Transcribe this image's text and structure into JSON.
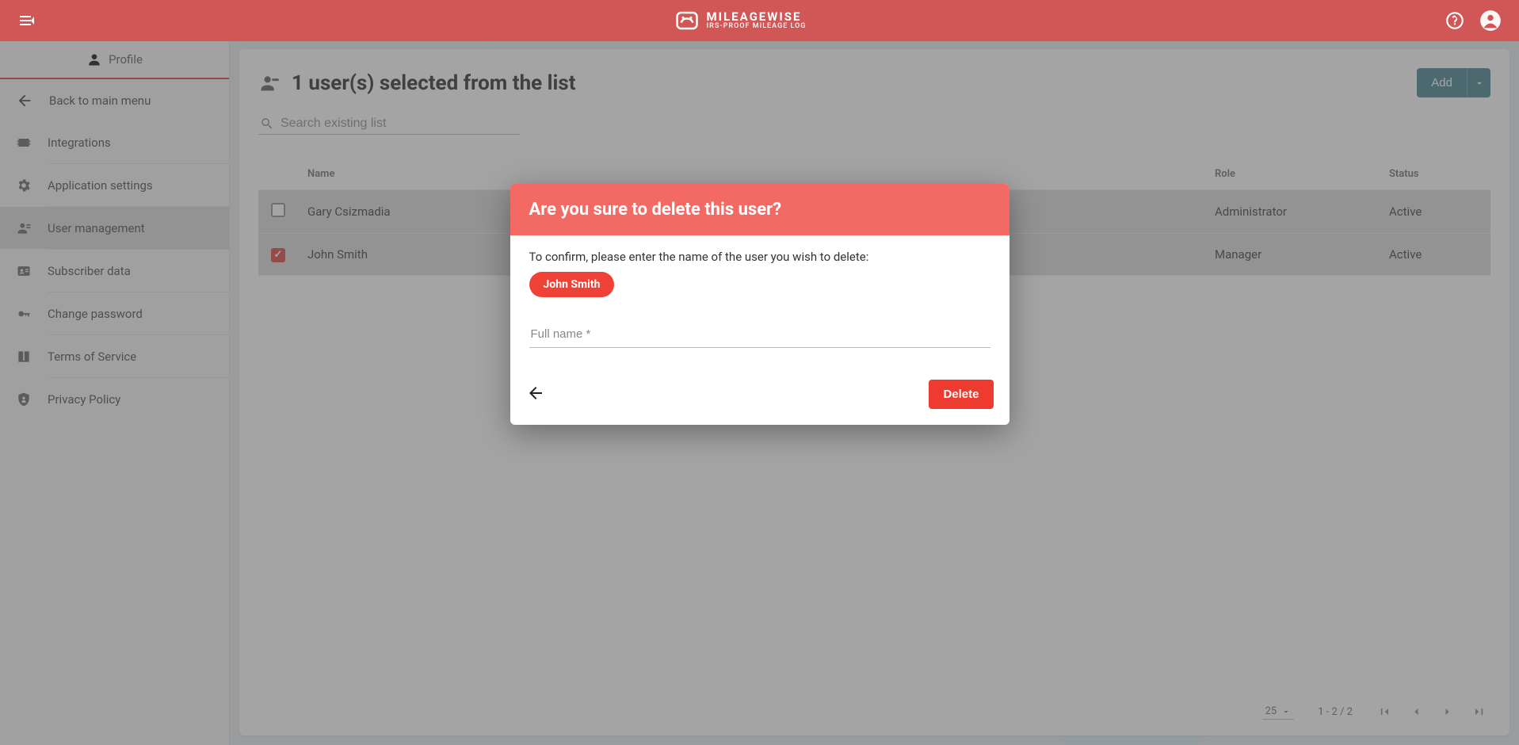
{
  "brand": {
    "name": "MILEAGEWISE",
    "tagline": "IRS-PROOF MILEAGE LOG"
  },
  "sidebar": {
    "profile_label": "Profile",
    "back_label": "Back to main menu",
    "items": [
      {
        "label": "Integrations"
      },
      {
        "label": "Application settings"
      },
      {
        "label": "User management"
      },
      {
        "label": "Subscriber data"
      },
      {
        "label": "Change password"
      },
      {
        "label": "Terms of Service"
      },
      {
        "label": "Privacy Policy"
      }
    ]
  },
  "main": {
    "title": "1 user(s) selected from the list",
    "add_label": "Add",
    "search_placeholder": "Search existing list",
    "columns": {
      "name": "Name",
      "role": "Role",
      "status": "Status"
    },
    "rows": [
      {
        "name": "Gary Csizmadia",
        "role": "Administrator",
        "status": "Active",
        "checked": false
      },
      {
        "name": "John Smith",
        "role": "Manager",
        "status": "Active",
        "checked": true
      }
    ],
    "pager": {
      "page_size": "25",
      "range": "1 - 2 / 2"
    }
  },
  "modal": {
    "title": "Are you sure to delete this user?",
    "confirm_text": "To confirm, please enter the name of the user you wish to delete:",
    "chip": "John Smith",
    "input_placeholder": "Full name *",
    "delete_label": "Delete"
  }
}
